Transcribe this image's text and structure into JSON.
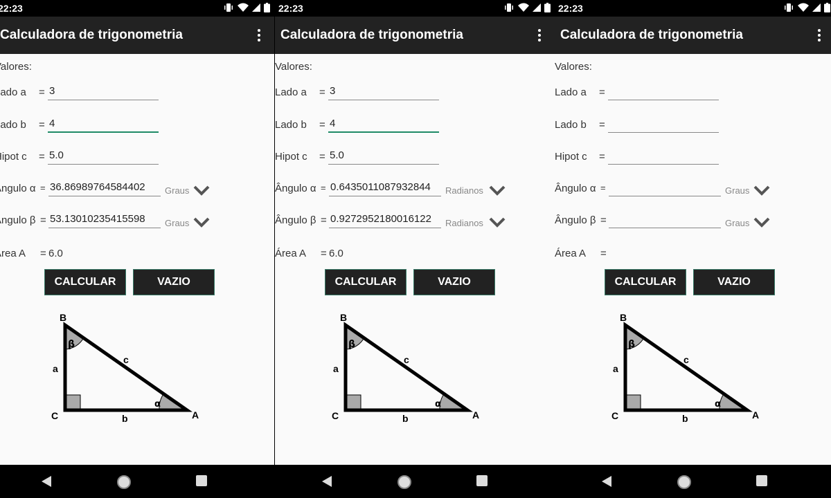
{
  "status_time": "22:23",
  "app_title": "Calculadora de trigonometria",
  "labels": {
    "values_heading": "Valores:",
    "side_a": "Lado a",
    "side_b": "Lado b",
    "hyp_c": "Hipot c",
    "angle_alpha": "Ângulo α",
    "angle_beta": "Ângulo β",
    "area": "Área A",
    "eq": "="
  },
  "buttons": {
    "calculate": "CALCULAR",
    "clear": "VAZIO"
  },
  "diagram": {
    "vertex_b": "B",
    "vertex_c": "C",
    "vertex_a": "A",
    "side_a": "a",
    "side_b": "b",
    "side_c": "c",
    "alpha": "α",
    "beta": "β"
  },
  "screens": [
    {
      "side_a": "3",
      "side_b": "4",
      "hyp_c": "5.0",
      "alpha": "36.86989764584402",
      "alpha_unit": "Graus",
      "beta": "53.13010235415598",
      "beta_unit": "Graus",
      "area": "6.0"
    },
    {
      "side_a": "3",
      "side_b": "4",
      "hyp_c": "5.0",
      "alpha": "0.6435011087932844",
      "alpha_unit": "Radianos",
      "beta": "0.9272952180016122",
      "beta_unit": "Radianos",
      "area": "6.0"
    },
    {
      "side_a": "",
      "side_b": "",
      "hyp_c": "",
      "alpha": "",
      "alpha_unit": "Graus",
      "beta": "",
      "beta_unit": "Graus",
      "area": ""
    }
  ]
}
